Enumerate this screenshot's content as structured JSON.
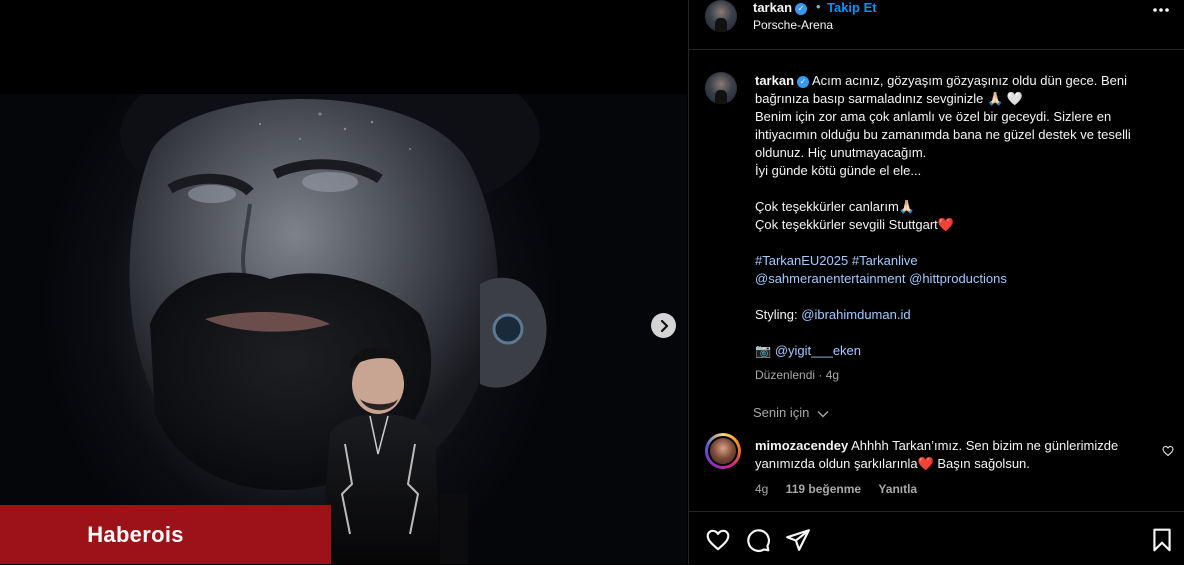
{
  "media": {
    "watermark": "Haberois"
  },
  "header": {
    "username": "tarkan",
    "separator": "•",
    "follow_label": "Takip Et",
    "location": "Porsche-Arena"
  },
  "caption": {
    "username": "tarkan",
    "lines": [
      "Acım acınız, gözyaşım gözyaşınız oldu dün gece. Beni",
      "bağrınıza basıp sarmaladınız sevginizle 🙏🏻 🤍",
      "Benim için zor ama çok anlamlı ve özel bir geceydi. Sizlere en",
      "ihtiyacımın olduğu bu zamanımda bana ne güzel destek ve teselli",
      "oldunuz. Hiç unutmayacağım.",
      "İyi günde kötü günde el ele...",
      "",
      "Çok teşekkürler canlarım🙏🏻",
      "Çok teşekkürler sevgili Stuttgart❤️"
    ],
    "hashtags": "#TarkanEU2025 #Tarkanlive",
    "mention_1": "@sahmeranentertainment",
    "mention_2": "@hittproductions",
    "styling_label": "Styling:",
    "styling_mention": "@ibrahimduman.id",
    "camera_emoji": "📷",
    "photo_mention": "@yigit___eken",
    "meta": "Düzenlendi · 4g"
  },
  "for_you": {
    "label": "Senin için",
    "chevron": "⌵"
  },
  "comment": {
    "username": "mimozacendey",
    "text_1": "Ahhhh Tarkan’ımız. Sen bizim ne günlerimizde",
    "text_2": "yanımızda oldun şarkılarınla❤️  Başın sağolsun.",
    "time": "4g",
    "likes": "119 beğenme",
    "reply": "Yanıtla"
  },
  "icons": {
    "verified": "verified-badge-icon",
    "more": "more-horizontal-icon",
    "next": "chevron-right-icon",
    "like": "heart-icon",
    "comment": "comment-bubble-icon",
    "share": "paper-plane-icon",
    "save": "bookmark-icon"
  },
  "colors": {
    "link_blue": "#0095f6",
    "mention_blue": "#a3c9ff",
    "watermark_red": "#9d1218",
    "muted_text": "#a8a8a8",
    "divider": "#262626"
  }
}
